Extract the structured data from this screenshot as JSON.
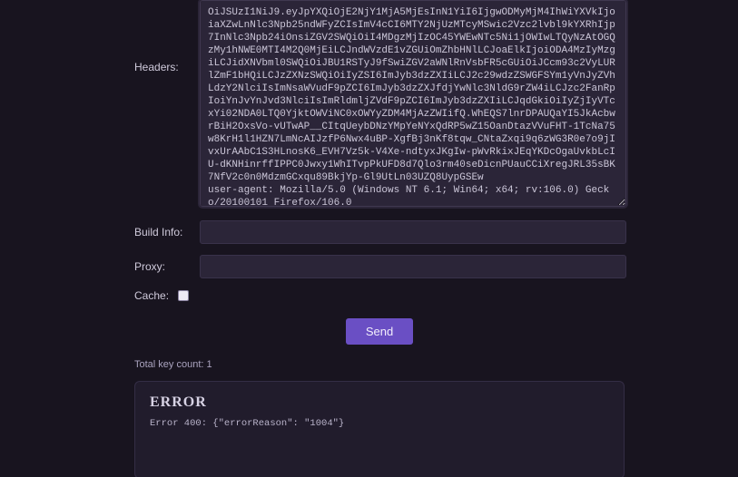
{
  "labels": {
    "headers": "Headers:",
    "build_info": "Build Info:",
    "proxy": "Proxy:",
    "cache": "Cache:"
  },
  "fields": {
    "headers_value": "OiJSUzI1NiJ9.eyJpYXQiOjE2NjY1MjA5MjEsInN1YiI6IjgwODMyMjM4IhWiYXVkIjoiaXZwLnNlc3Npb25ndWFyZCIsImV4cCI6MTY2NjUzMTcyMSwic2Vzc2lvbl9kYXRhIjp7InNlc3Npb24iOnsiZGV2SWQiOiI4MDgzMjIzOC45YWEwNTc5Ni1jOWIwLTQyNzAtOGQzMy1hNWE0MTI4M2Q0MjEiLCJndWVzdE1vZGUiOmZhbHNlLCJoaElkIjoiODA4MzIyMzgiLCJidXNVbml0SWQiOiJBU1RSTyJ9fSwiZGV2aWNlRnVsbFR5cGUiOiJCcm93c2VyLURlZmF1bHQiLCJzZXNzSWQiOiIyZSI6ImJyb3dzZXIiLCJ2c29wdzZSWGFSYm1yVnJyZVhLdzY2NlciIsImNsaWVudF9pZCI6ImJyb3dzZXJfdjYwNlc3NldG9rZW4iLCJzc2FanRpIoiYnJvYnJvd3NlciIsImRldmljZVdF9pZCI6ImJyb3dzZXIiLCJqdGkiOiIyZjIyVTcxYi02NDA0LTQ0YjktOWViNC0xOWYyZDM4MjAzZWIifQ.WhEQS7lnrDPAUQaYI5JkAcbwrBiH2OxsVo-vUTwAP__CItqUeybDNzYMpYeNYxQdRP5wZ15OanDtazVVuFHT-1TcNa75w8KrH1l1HZN7LmNcAIJzfP6Nwx4uBP-XgfBj3nKf8tqw_CNtaZxqi9q6zWG3R0e7o9jIvxUrAAbC1S3HLnosK6_EVH7Vz5k-V4Xe-ndtyxJKgIw-pWvRkixJEqYKDcOgaUvkbLcIU-dKNHinrffIPPC0Jwxy1WhITvpPkUFD8d7Qlo3rm40seDicnPUauCCiXregJRL35sBK7NfV2c0n0MdzmGCxqu89BkjYp-Gl9UtLn03UZQ8UypGSEw\nuser-agent: Mozilla/5.0 (Windows NT 6.1; Win64; x64; rv:106.0) Gecko/20100101 Firefox/106.0",
    "build_info_value": "",
    "proxy_value": "",
    "cache_checked": false
  },
  "actions": {
    "send_label": "Send"
  },
  "totals": {
    "text": "Total key count: 1",
    "count": 1
  },
  "error": {
    "title": "ERROR",
    "body": "Error 400: {\"errorReason\": \"1004\"}",
    "status": 400,
    "reason_code": "1004"
  }
}
